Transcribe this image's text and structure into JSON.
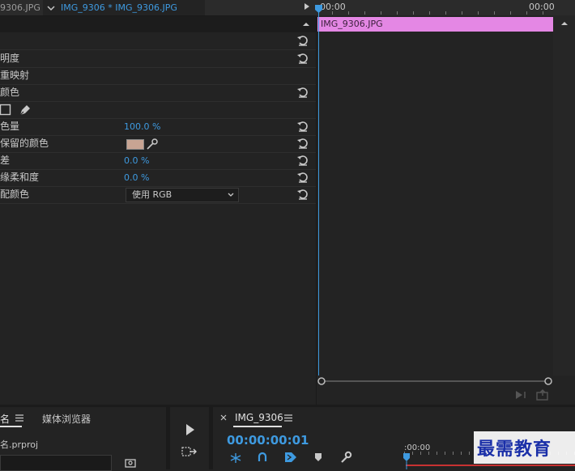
{
  "tabs": {
    "left_partial": "9306.JPG",
    "active": "IMG_9306 * IMG_9306.JPG"
  },
  "timeline": {
    "tc_left": "00:00",
    "tc_right": "00:00",
    "clip_label": "IMG_9306.JPG"
  },
  "effect_rows": [
    {
      "label": "明度",
      "value": "",
      "reset": true
    },
    {
      "label": "重映射",
      "value": "",
      "reset": false
    },
    {
      "label": "颜色",
      "value": "",
      "reset": true
    },
    {
      "label": "色量",
      "value": "100.0 %",
      "reset": true
    },
    {
      "label": "保留的颜色",
      "value": "",
      "reset": true
    },
    {
      "label": "差",
      "value": "0.0 %",
      "reset": true
    },
    {
      "label": "缘柔和度",
      "value": "0.0 %",
      "reset": true
    },
    {
      "label": "配颜色",
      "value": "",
      "reset": true
    }
  ],
  "match_colors_select": "使用 RGB",
  "swatch_color": "#c8a493",
  "project_panel": {
    "tab_name": "名",
    "tab_media_browser": "媒体浏览器",
    "file": "名.prproj"
  },
  "sequence_panel": {
    "tab_name": "IMG_9306",
    "timecode": "00:00:00:01",
    "ruler_tc": ":00:00"
  },
  "watermark": "最需教育"
}
